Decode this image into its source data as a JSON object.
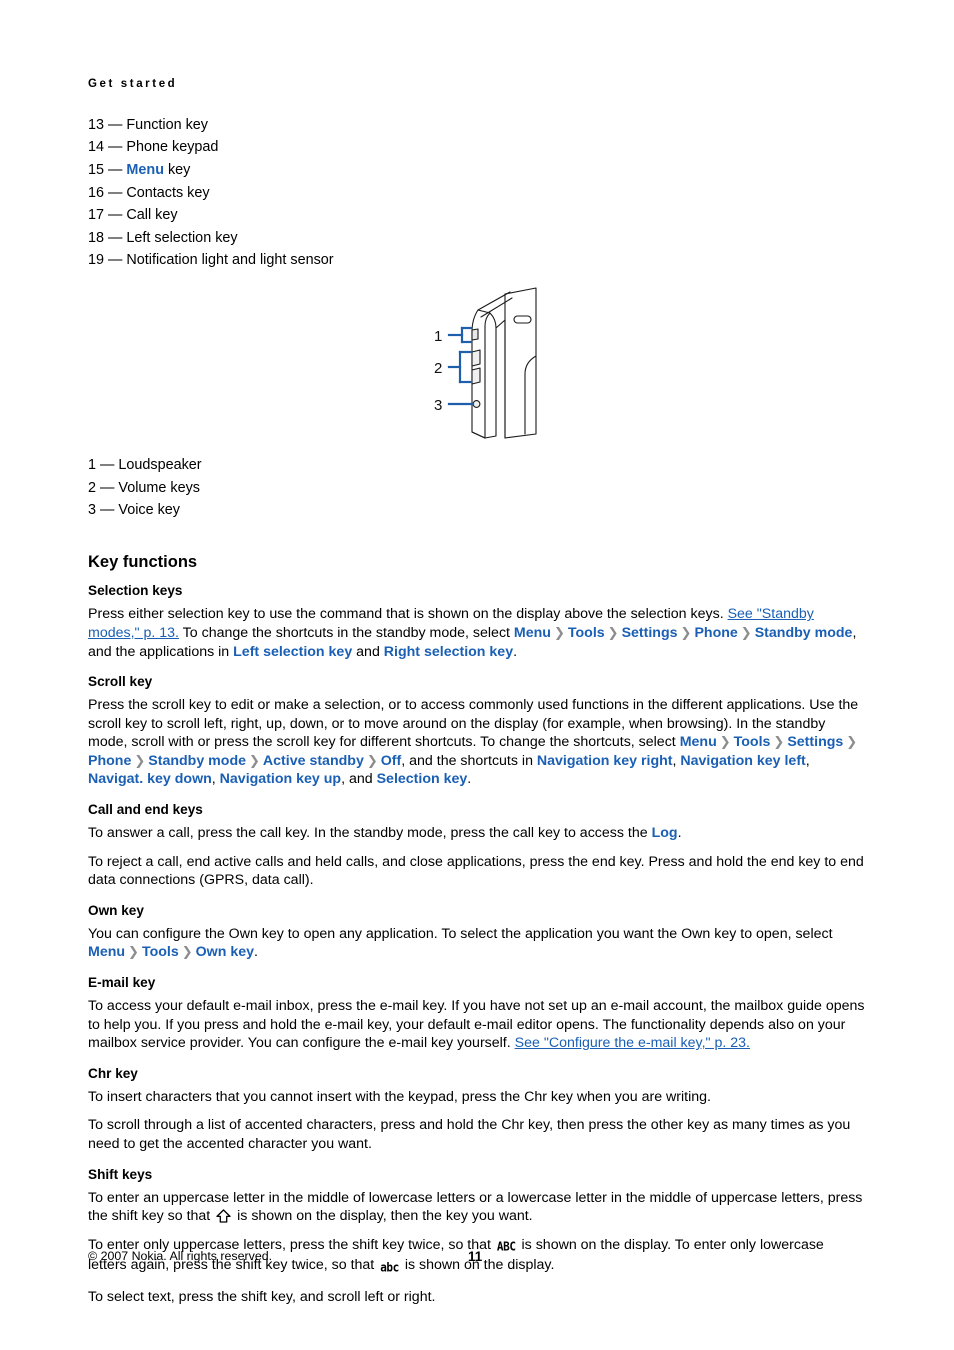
{
  "document": {
    "running_head": "Get started",
    "page_number": "11",
    "copyright": "© 2007 Nokia. All rights reserved.",
    "link_color": "#1a5fb4",
    "separator_color": "#8d8d8d"
  },
  "legend_top": [
    {
      "num": "13",
      "text": "Function key"
    },
    {
      "num": "14",
      "pre": "",
      "ui": "Menu",
      "post": " key"
    },
    {
      "num": "15",
      "text": "Phone keypad"
    },
    {
      "num": "16",
      "text": "Contacts key"
    },
    {
      "num": "17",
      "text": "Call key"
    },
    {
      "num": "18",
      "text": "Left selection key"
    },
    {
      "num": "19",
      "text": "Notification light and light sensor"
    }
  ],
  "legend_top_items": {
    "i0": "13 — Function key",
    "i1": "14 — Phone keypad",
    "i2_num": "15 —",
    "i2_ui": "Menu",
    "i2_tail": "key",
    "i3": "16 — Contacts key",
    "i4": "17 — Call key",
    "i5": "18 — Left selection key",
    "i6": "19 — Notification light and light sensor"
  },
  "figure": {
    "name": "phone-side-view-diagram",
    "callouts": [
      {
        "label": "1",
        "target": "Loudspeaker"
      },
      {
        "label": "2",
        "target": "Volume keys"
      },
      {
        "label": "3",
        "target": "Voice key"
      }
    ],
    "callout_1": "1",
    "callout_2": "2",
    "callout_3": "3"
  },
  "legend_bottom": {
    "i0": "1 — Loudspeaker",
    "i1": "2 — Volume keys",
    "i2": "3 — Voice key"
  },
  "sections": {
    "key_functions_heading": "Key functions",
    "selection_keys_heading": "Selection keys",
    "selection_p1_a": "Press either selection key to use the command that is shown on the display above the selection keys. ",
    "selection_p1_xref": "See \"Standby modes,\" p. 13.",
    "selection_p1_b": " To change the shortcuts in the standby mode, select ",
    "selection_p1_menu": "Menu",
    "selection_p1_tools": "Tools",
    "selection_p1_settings": "Settings",
    "selection_p1_phone": "Phone",
    "selection_p1_standby": "Standby mode",
    "selection_p1_c": ", and the applications in ",
    "selection_p1_left": "Left selection key",
    "selection_p1_and": " and ",
    "selection_p1_right": "Right selection key",
    "selection_p1_end": ".",
    "scroll_key_heading": "Scroll key",
    "scroll_p1_a": "Press the scroll key to edit or make a selection, or to access commonly used functions in the different applications. Use the scroll key to scroll left, right, up, down, or to move around on the display (for example, when browsing). In the standby mode, scroll with or press the scroll key for different shortcuts. To change the shortcuts, select ",
    "scroll_menu": "Menu",
    "scroll_tools": "Tools",
    "scroll_settings": "Settings",
    "scroll_phone": "Phone",
    "scroll_standby_mode": "Standby mode",
    "scroll_active_standby": "Active standby",
    "scroll_off": "Off",
    "scroll_p1_b": ", and the shortcuts in ",
    "scroll_nav_right": "Navigation key right",
    "scroll_nav_left": "Navigation key left",
    "scroll_nav_down": "Navigat. key down",
    "scroll_nav_up": "Navigation key up",
    "scroll_p1_c": ", and ",
    "scroll_selection_key": "Selection key",
    "scroll_p1_end": ".",
    "call_end_heading": "Call and end keys",
    "call_p1_a": "To answer a call, press the call key. In the standby mode, press the call key to access the ",
    "call_p1_log": "Log",
    "call_p1_end": ".",
    "call_p2": "To reject a call, end active calls and held calls, and close applications, press the end key. Press and hold the end key to end data connections (GPRS, data call).",
    "own_key_heading": "Own key",
    "own_p1_a": "You can configure the Own key to open any application. To select the application you want the Own key to open, select ",
    "own_menu": "Menu",
    "own_tools": "Tools",
    "own_ownkey": "Own key",
    "own_p1_end": ".",
    "email_key_heading": "E-mail key",
    "email_p1_a": "To access your default e-mail inbox, press the e-mail key. If you have not set up an e-mail account, the mailbox guide opens to help you. If you press and hold the e-mail key, your default e-mail editor opens. The functionality depends also on your mailbox service provider. You can configure the e-mail key yourself. ",
    "email_p1_xref": "See \"Configure the e-mail key,\" p. 23.",
    "chr_key_heading": "Chr key",
    "chr_p1": "To insert characters that you cannot insert with the keypad, press the Chr key when you are writing.",
    "chr_p2": "To scroll through a list of accented characters, press and hold the Chr key, then press the other key as many times as you need to get the accented character you want.",
    "shift_keys_heading": "Shift keys",
    "shift_p1_a": "To enter an uppercase letter in the middle of lowercase letters or a lowercase letter in the middle of uppercase letters, press the shift key so that ",
    "shift_p1_glyph": "shift-arrow-glyph",
    "shift_p1_b": " is shown on the display, then the key you want.",
    "shift_p2_a": "To enter only uppercase letters, press the shift key twice, so that ",
    "shift_p2_abc_upper": "ABC",
    "shift_p2_b": " is shown on the display. To enter only lowercase letters again, press the shift key twice, so that ",
    "shift_p2_abc_lower": "abc",
    "shift_p2_c": " is shown on the display.",
    "shift_p3": "To select text, press the shift key, and scroll left or right."
  }
}
